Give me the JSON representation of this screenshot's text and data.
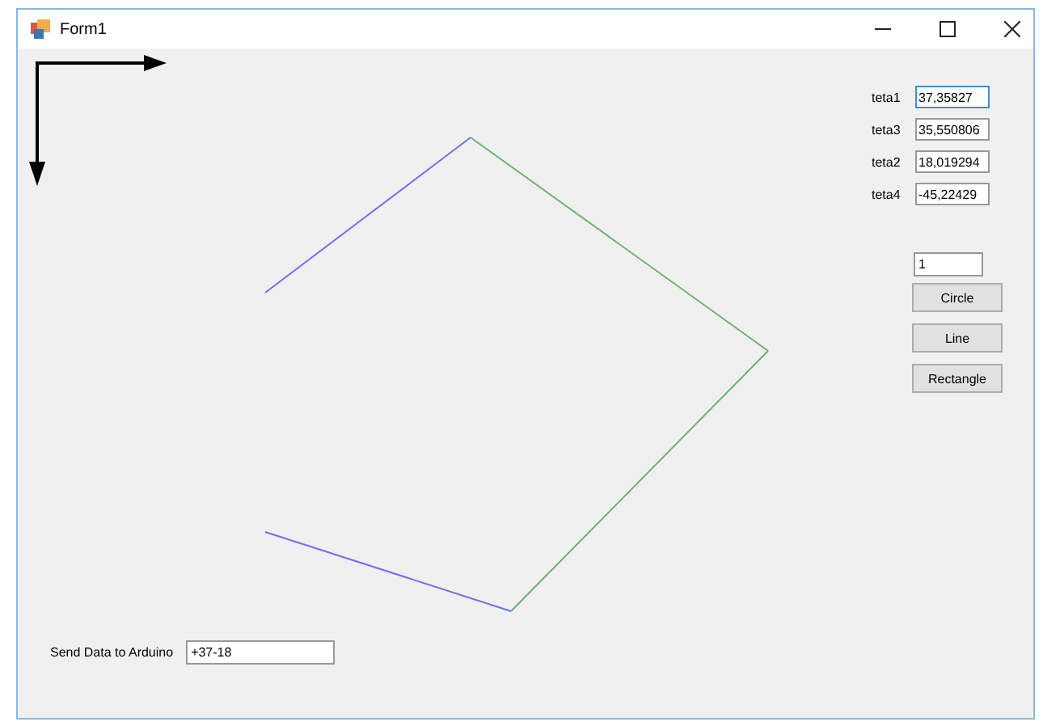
{
  "window": {
    "title": "Form1"
  },
  "angles": [
    {
      "label": "teta1",
      "value": "37,35827",
      "focused": true
    },
    {
      "label": "teta3",
      "value": "35,550806",
      "focused": false
    },
    {
      "label": "teta2",
      "value": "18,019294",
      "focused": false
    },
    {
      "label": "teta4",
      "value": "-45,22429",
      "focused": false
    }
  ],
  "number_field": {
    "value": "1"
  },
  "buttons": [
    "Circle",
    "Line",
    "Rectangle"
  ],
  "send": {
    "label": "Send Data to Arduino",
    "value": "+37-18"
  }
}
